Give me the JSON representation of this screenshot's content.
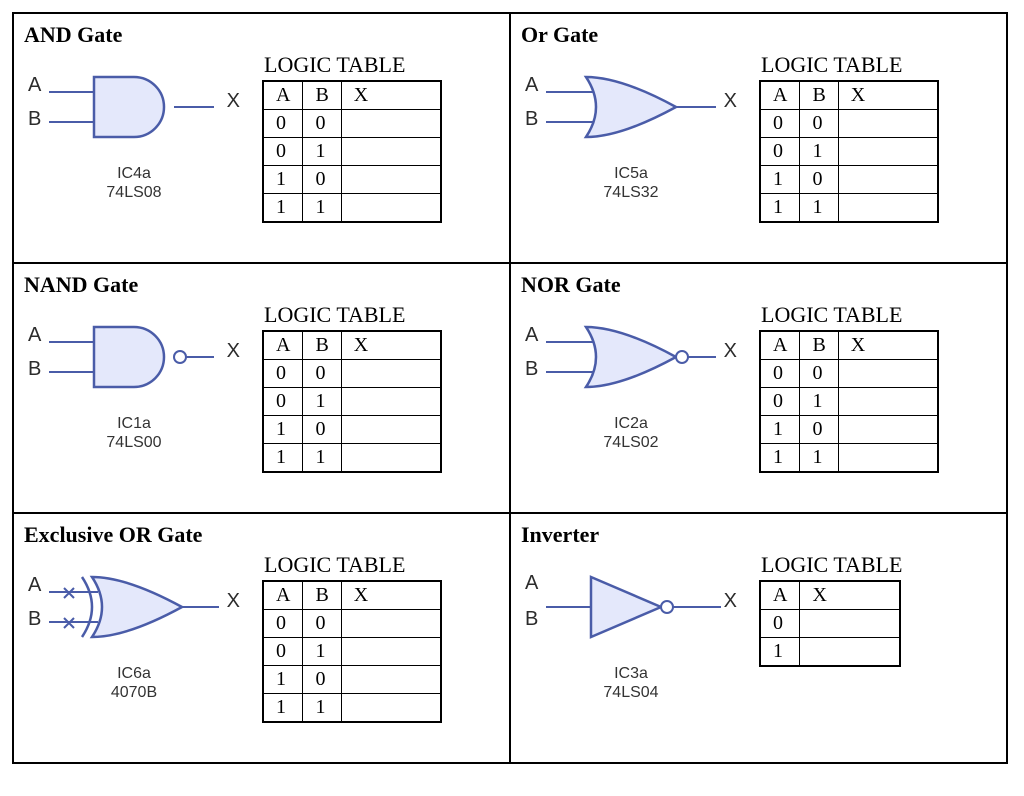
{
  "common": {
    "table_title": "LOGIC TABLE",
    "input_a": "A",
    "input_b": "B",
    "output_x": "X",
    "header_a": "A",
    "header_b": "B",
    "header_x": "X"
  },
  "gates": [
    {
      "title": "AND Gate",
      "ic_line1": "IC4a",
      "ic_line2": "74LS08",
      "symbol": "and",
      "two_input": true,
      "rows": [
        {
          "a": "0",
          "b": "0",
          "x": ""
        },
        {
          "a": "0",
          "b": "1",
          "x": ""
        },
        {
          "a": "1",
          "b": "0",
          "x": ""
        },
        {
          "a": "1",
          "b": "1",
          "x": ""
        }
      ]
    },
    {
      "title": "Or Gate",
      "ic_line1": "IC5a",
      "ic_line2": "74LS32",
      "symbol": "or",
      "two_input": true,
      "rows": [
        {
          "a": "0",
          "b": "0",
          "x": ""
        },
        {
          "a": "0",
          "b": "1",
          "x": ""
        },
        {
          "a": "1",
          "b": "0",
          "x": ""
        },
        {
          "a": "1",
          "b": "1",
          "x": ""
        }
      ]
    },
    {
      "title": "NAND Gate",
      "ic_line1": "IC1a",
      "ic_line2": "74LS00",
      "symbol": "nand",
      "two_input": true,
      "rows": [
        {
          "a": "0",
          "b": "0",
          "x": ""
        },
        {
          "a": "0",
          "b": "1",
          "x": ""
        },
        {
          "a": "1",
          "b": "0",
          "x": ""
        },
        {
          "a": "1",
          "b": "1",
          "x": ""
        }
      ]
    },
    {
      "title": "NOR Gate",
      "ic_line1": "IC2a",
      "ic_line2": "74LS02",
      "symbol": "nor",
      "two_input": true,
      "rows": [
        {
          "a": "0",
          "b": "0",
          "x": ""
        },
        {
          "a": "0",
          "b": "1",
          "x": ""
        },
        {
          "a": "1",
          "b": "0",
          "x": ""
        },
        {
          "a": "1",
          "b": "1",
          "x": ""
        }
      ]
    },
    {
      "title": "Exclusive OR Gate",
      "ic_line1": "IC6a",
      "ic_line2": "4070B",
      "symbol": "xor",
      "two_input": true,
      "rows": [
        {
          "a": "0",
          "b": "0",
          "x": ""
        },
        {
          "a": "0",
          "b": "1",
          "x": ""
        },
        {
          "a": "1",
          "b": "0",
          "x": ""
        },
        {
          "a": "1",
          "b": "1",
          "x": ""
        }
      ]
    },
    {
      "title": "Inverter",
      "ic_line1": "IC3a",
      "ic_line2": "74LS04",
      "symbol": "not",
      "two_input": false,
      "rows": [
        {
          "a": "0",
          "x": ""
        },
        {
          "a": "1",
          "x": ""
        }
      ]
    }
  ]
}
